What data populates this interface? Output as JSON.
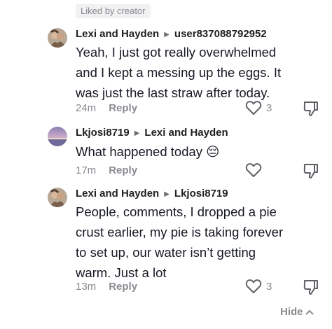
{
  "badge": {
    "label": "Liked by creator"
  },
  "comments": [
    {
      "author": "Lexi and Hayden",
      "reply_to": "user837088792952",
      "text_lines": [
        "Yeah, I just got really overwhelmed",
        "and I kept a messing up the eggs. It",
        "was just the last straw after today."
      ],
      "time": "24m",
      "reply_label": "Reply",
      "likes": "3"
    },
    {
      "author": "Lkjosi8719",
      "reply_to": "Lexi and Hayden",
      "text_lines": [
        "What happened today 😔"
      ],
      "time": "17m",
      "reply_label": "Reply",
      "likes": ""
    },
    {
      "author": "Lexi and Hayden",
      "reply_to": "Lkjosi8719",
      "text_lines": [
        "People, comments, I dropped a pie",
        "crust earlier, my pie is taking forever",
        "to set up, our water isn’t getting",
        "warm. Just a lot"
      ],
      "time": "13m",
      "reply_label": "Reply",
      "likes": "3"
    }
  ],
  "footer": {
    "hide_label": "Hide"
  },
  "icons": {
    "avatar_1": "avatar-photo-icon",
    "avatar_2": "avatar-sunset-icon",
    "arrow": "reply-arrow-icon",
    "like": "heart-icon",
    "dislike": "thumbs-down-icon",
    "hide": "chevron-up-icon"
  }
}
